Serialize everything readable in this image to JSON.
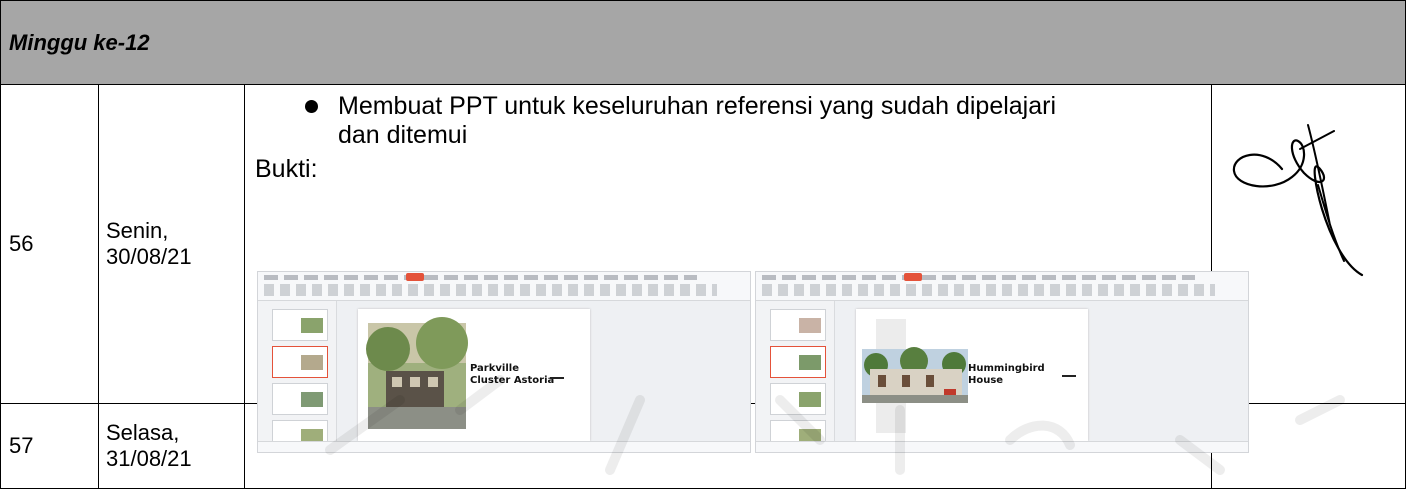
{
  "week_title": "Minggu ke-12",
  "rows": [
    {
      "number": "56",
      "date": "Senin,\n30/08/21",
      "activity": "Membuat PPT untuk keseluruhan referensi yang sudah dipelajari dan ditemui",
      "proof_label": "Bukti:",
      "screenshots": [
        {
          "slide_title": "Parkville\nCluster Astoria"
        },
        {
          "slide_title": "Hummingbird\nHouse"
        }
      ]
    },
    {
      "number": "57",
      "date": "Selasa,\n31/08/21",
      "activity": "-"
    }
  ],
  "watermark_letters": [
    "N",
    "I",
    "V",
    "E",
    "R",
    "S",
    "I",
    "T"
  ]
}
